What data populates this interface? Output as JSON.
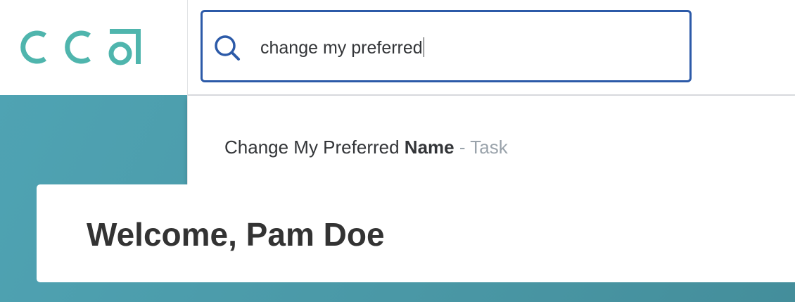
{
  "header": {
    "logo_text": "cca",
    "brand_color": "#4fb5ad"
  },
  "search": {
    "value": "change my preferred",
    "border_color": "#2c5aa8",
    "icon": "search-icon"
  },
  "suggestions": [
    {
      "prefix": "Change My Preferred ",
      "highlight": "Name",
      "type_label": " - Task"
    }
  ],
  "main": {
    "welcome_title": "Welcome, Pam Doe",
    "hero_color": "#4a98a6"
  }
}
